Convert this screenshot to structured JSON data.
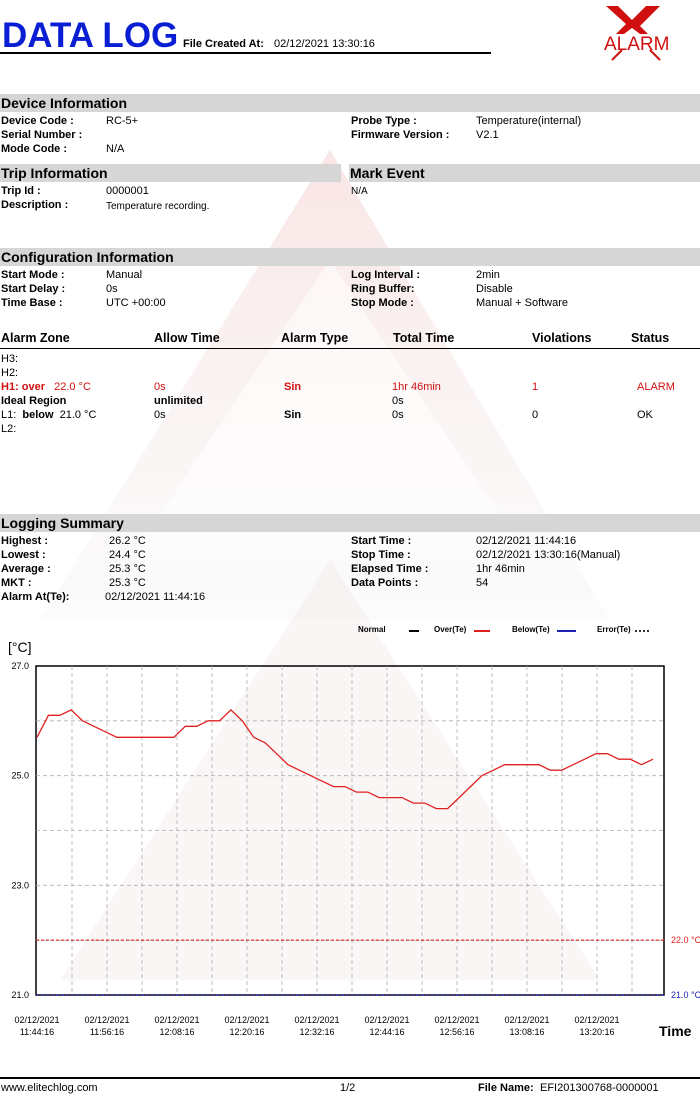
{
  "header": {
    "title": "DATA LOG",
    "file_created_label": "File Created At:",
    "file_created_value": "02/12/2021 13:30:16",
    "alarm_logo_text": "ALARM"
  },
  "device": {
    "section_title": "Device Information",
    "device_code_label": "Device Code :",
    "device_code_value": "RC-5+",
    "serial_label": "Serial Number :",
    "serial_value": "",
    "mode_label": "Mode Code :",
    "mode_value": "N/A",
    "probe_label": "Probe Type :",
    "probe_value": "Temperature(internal)",
    "firmware_label": "Firmware Version :",
    "firmware_value": "V2.1"
  },
  "trip": {
    "section_title": "Trip Information",
    "trip_id_label": "Trip Id :",
    "trip_id_value": "0000001",
    "desc_label": "Description :",
    "desc_value": "Temperature recording."
  },
  "mark_event": {
    "section_title": "Mark Event",
    "value": "N/A"
  },
  "config": {
    "section_title": "Configuration Information",
    "start_mode_label": "Start Mode :",
    "start_mode_value": "Manual",
    "start_delay_label": "Start Delay :",
    "start_delay_value": "0s",
    "time_base_label": "Time Base :",
    "time_base_value": "UTC +00:00",
    "log_interval_label": "Log Interval :",
    "log_interval_value": "2min",
    "ring_buffer_label": "Ring Buffer:",
    "ring_buffer_value": "Disable",
    "stop_mode_label": "Stop Mode :",
    "stop_mode_value": "Manual + Software"
  },
  "alarm_table": {
    "headers": [
      "Alarm Zone",
      "Allow Time",
      "Alarm Type",
      "Total Time",
      "Violations",
      "Status"
    ],
    "h3": "H3:",
    "h2": "H2:",
    "h1": {
      "zone_prefix": "H1: over",
      "zone_value": "22.0 °C",
      "allow": "0s",
      "type": "Sin",
      "total": "1hr 46min",
      "violations": "1",
      "status": "ALARM"
    },
    "ideal": {
      "zone": "Ideal Region",
      "allow": "unlimited",
      "total": "0s"
    },
    "l1": {
      "zone_prefix": "L1:",
      "zone_mid": "below",
      "zone_value": "21.0 °C",
      "allow": "0s",
      "type": "Sin",
      "total": "0s",
      "violations": "0",
      "status": "OK"
    },
    "l2": "L2:"
  },
  "summary": {
    "section_title": "Logging Summary",
    "highest_label": "Highest :",
    "highest_value": "26.2 °C",
    "lowest_label": "Lowest :",
    "lowest_value": "24.4 °C",
    "average_label": "Average :",
    "average_value": "25.3 °C",
    "mkt_label": "MKT :",
    "mkt_value": "25.3 °C",
    "alarm_at_label": "Alarm At(Te):",
    "alarm_at_value": "02/12/2021 11:44:16",
    "start_time_label": "Start Time :",
    "start_time_value": "02/12/2021 11:44:16",
    "stop_time_label": "Stop Time :",
    "stop_time_value": "02/12/2021 13:30:16(Manual)",
    "elapsed_label": "Elapsed Time :",
    "elapsed_value": "1hr 46min",
    "points_label": "Data Points :",
    "points_value": "54"
  },
  "legend": {
    "normal": "Normal",
    "over": "Over(Te)",
    "below": "Below(Te)",
    "error": "Error(Te)"
  },
  "footer": {
    "website": "www.elitechlog.com",
    "page": "1/2",
    "file_name_label": "File Name:",
    "file_name_value": "EFI201300768-0000001"
  },
  "colors": {
    "brand_red": "#d01010",
    "over_line": "#e02020",
    "below_line": "#2020b0",
    "band": "#d6d6d6"
  },
  "chart_data": {
    "type": "line",
    "ylabel": "[°C]",
    "xlabel": "Time",
    "ylim": [
      21.0,
      27.0
    ],
    "ytick_labels": [
      "21.0",
      "23.0",
      "25.0",
      "27.0"
    ],
    "x_tick_labels": [
      [
        "02/12/2021",
        "11:44:16"
      ],
      [
        "02/12/2021",
        "11:56:16"
      ],
      [
        "02/12/2021",
        "12:08:16"
      ],
      [
        "02/12/2021",
        "12:20:16"
      ],
      [
        "02/12/2021",
        "12:32:16"
      ],
      [
        "02/12/2021",
        "12:44:16"
      ],
      [
        "02/12/2021",
        "12:56:16"
      ],
      [
        "02/12/2021",
        "13:08:16"
      ],
      [
        "02/12/2021",
        "13:20:16"
      ]
    ],
    "thresholds": [
      {
        "label": "22.0 °C",
        "value": 22.0,
        "color": "#e02020"
      },
      {
        "label": "21.0 °C",
        "value": 21.0,
        "color": "#2020b0"
      }
    ],
    "grid": true,
    "series": [
      {
        "color": "#e02020",
        "values": [
          25.7,
          26.1,
          26.1,
          26.2,
          26.0,
          25.9,
          25.8,
          25.7,
          25.7,
          25.7,
          25.7,
          25.7,
          25.7,
          25.9,
          25.9,
          26.0,
          26.0,
          26.2,
          26.0,
          25.7,
          25.6,
          25.4,
          25.2,
          25.1,
          25.0,
          24.9,
          24.8,
          24.8,
          24.7,
          24.7,
          24.6,
          24.6,
          24.6,
          24.5,
          24.5,
          24.4,
          24.4,
          24.6,
          24.8,
          25.0,
          25.1,
          25.2,
          25.2,
          25.2,
          25.2,
          25.1,
          25.1,
          25.2,
          25.3,
          25.4,
          25.4,
          25.3,
          25.3,
          25.2,
          25.3
        ]
      }
    ]
  }
}
